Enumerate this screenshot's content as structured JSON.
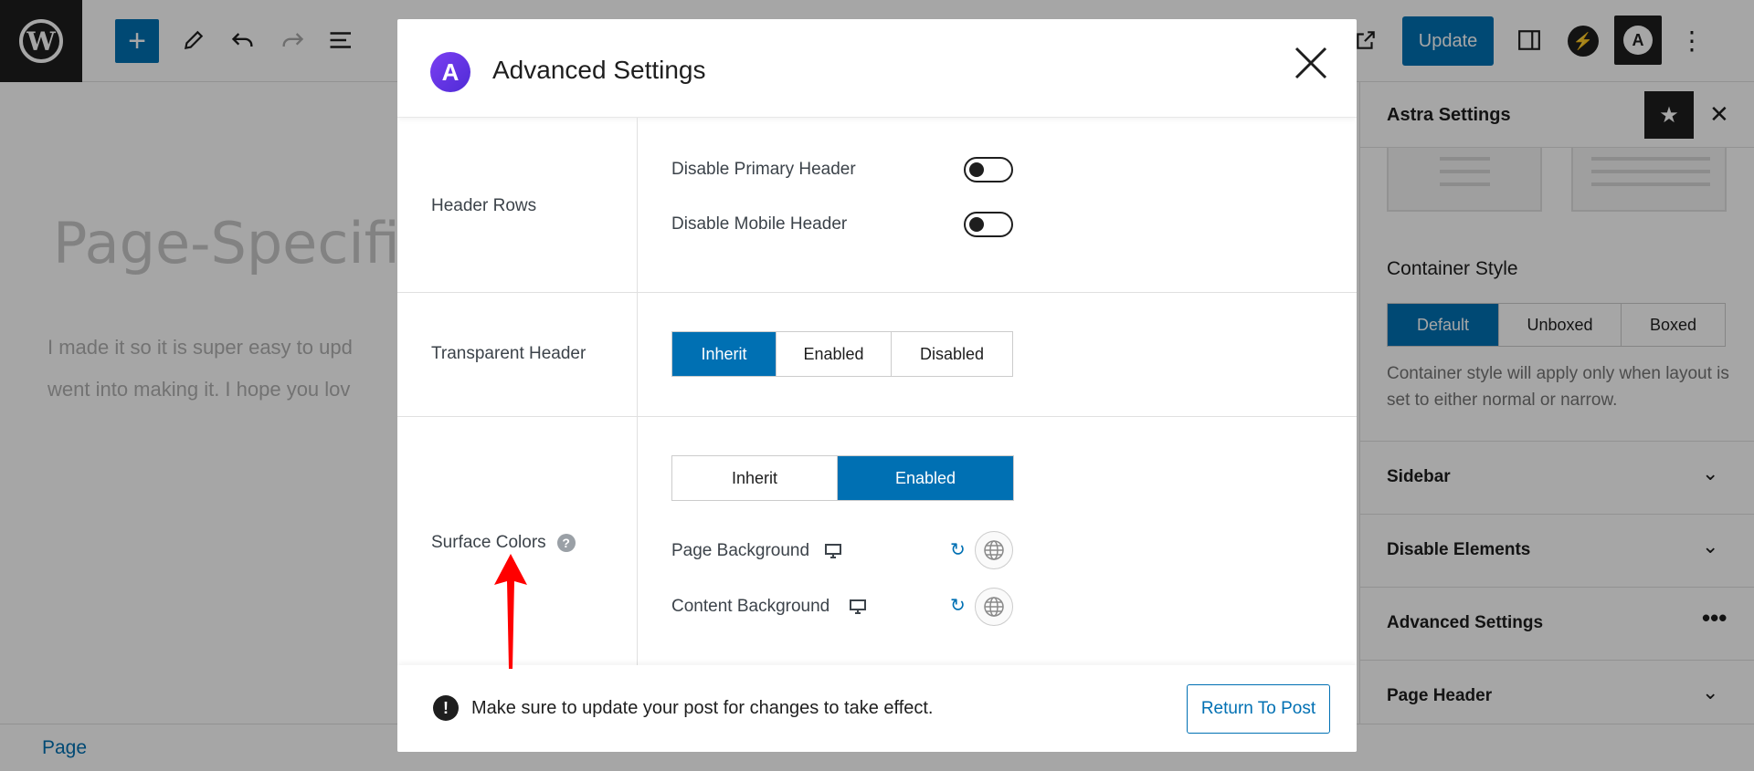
{
  "topbar": {
    "update_label": "Update",
    "add_icon": "plus-icon",
    "icons": [
      "pencil-icon",
      "undo-icon",
      "redo-icon",
      "list-view-icon",
      "external-link-icon",
      "sidebar-toggle-icon",
      "spark-icon",
      "astra-icon",
      "more-vertical-icon"
    ]
  },
  "canvas": {
    "page_title": "Page-Specific",
    "paragraph_line1": "I made it so it is super easy to upd",
    "paragraph_line2": "went into making it. I hope you lov"
  },
  "sidebar": {
    "title": "Astra Settings",
    "container_style_label": "Container Style",
    "container_style_options": [
      "Default",
      "Unboxed",
      "Boxed"
    ],
    "container_style_selected": "Default",
    "container_style_help": "Container style will apply only when layout is set to either normal or narrow.",
    "sections": [
      {
        "label": "Sidebar"
      },
      {
        "label": "Disable Elements"
      },
      {
        "label": "Advanced Settings"
      },
      {
        "label": "Page Header"
      }
    ]
  },
  "breadcrumb": {
    "label": "Page"
  },
  "modal": {
    "title": "Advanced Settings",
    "header_rows": {
      "label": "Header Rows",
      "options": [
        {
          "label": "Disable Primary Header",
          "on": false
        },
        {
          "label": "Disable Mobile Header",
          "on": false
        }
      ]
    },
    "transparent_header": {
      "label": "Transparent Header",
      "options": [
        "Inherit",
        "Enabled",
        "Disabled"
      ],
      "selected": "Inherit"
    },
    "surface_colors": {
      "label": "Surface Colors",
      "help": "?",
      "options": [
        "Inherit",
        "Enabled"
      ],
      "selected": "Enabled",
      "page_background_label": "Page Background",
      "content_background_label": "Content Background"
    },
    "footer": {
      "notice": "Make sure to update your post for changes to take effect.",
      "return_label": "Return To Post"
    }
  },
  "colors": {
    "accent": "#0070b3",
    "astra_purple": "#6a35e6",
    "annotation_red": "#ff0000"
  }
}
